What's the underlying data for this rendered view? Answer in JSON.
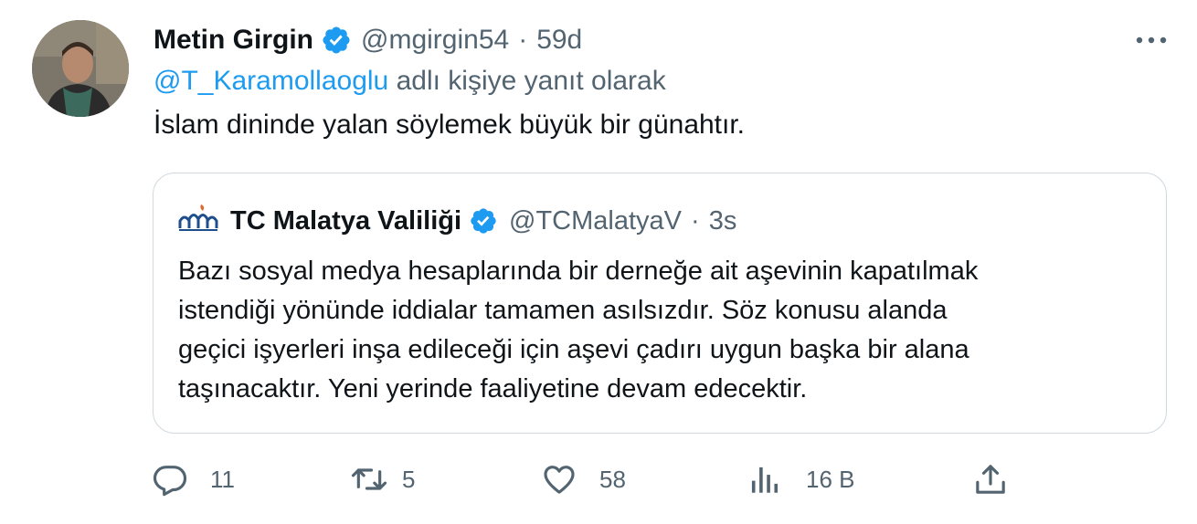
{
  "tweet": {
    "display_name": "Metin Girgin",
    "handle": "@mgirgin54",
    "separator": "·",
    "time": "59d",
    "more_label": "•••",
    "reply_to_handle": "@T_Karamollaoglu",
    "reply_to_suffix": " adlı kişiye yanıt olarak",
    "text": "İslam dininde yalan söylemek büyük bir günahtır."
  },
  "quote": {
    "display_name": "TC Malatya Valiliği",
    "handle": "@TCMalatyaV",
    "separator": "·",
    "time": "3s",
    "logo_text": "MALATYA VALİLİĞİ",
    "lines": [
      "Bazı sosyal medya hesaplarında bir derneğe ait aşevinin kapatılmak",
      "istendiği yönünde iddialar tamamen asılsızdır. Söz konusu alanda",
      "geçici işyerleri inşa edileceği için aşevi çadırı uygun başka bir alana",
      "taşınacaktır. Yeni yerinde faaliyetine devam edecektir."
    ]
  },
  "actions": {
    "replies": "11",
    "retweets": "5",
    "likes": "58",
    "views": "16 B"
  },
  "icons": {
    "verified": "verified-badge-icon",
    "more": "more-icon",
    "reply": "reply-icon",
    "retweet": "retweet-icon",
    "like": "heart-icon",
    "views": "views-icon",
    "share": "share-icon"
  },
  "colors": {
    "accent": "#1d9bf0",
    "secondary_text": "#536471",
    "primary_text": "#0f1419",
    "border": "#cfd9de"
  }
}
